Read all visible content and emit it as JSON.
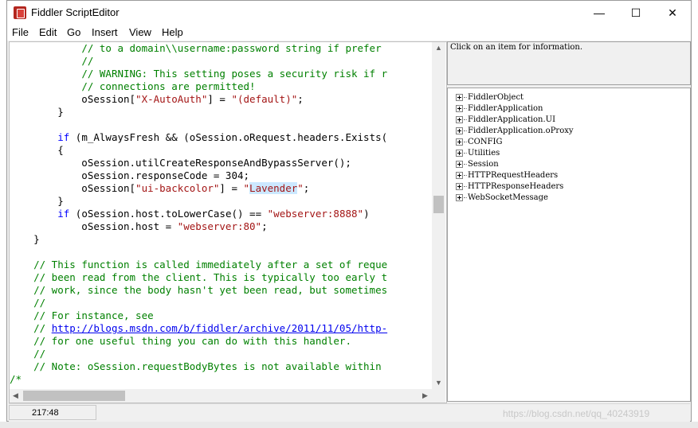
{
  "window": {
    "title": "Fiddler ScriptEditor",
    "min_glyph": "—",
    "max_glyph": "☐",
    "close_glyph": "✕"
  },
  "menu": [
    "File",
    "Edit",
    "Go",
    "Insert",
    "View",
    "Help"
  ],
  "code_lines": [
    [
      {
        "t": "            ",
        "c": ""
      },
      {
        "t": "// to a domain\\\\username:password string if prefer",
        "c": "c-comment"
      }
    ],
    [
      {
        "t": "            ",
        "c": ""
      },
      {
        "t": "//",
        "c": "c-comment"
      }
    ],
    [
      {
        "t": "            ",
        "c": ""
      },
      {
        "t": "// WARNING: This setting poses a security risk if r",
        "c": "c-comment"
      }
    ],
    [
      {
        "t": "            ",
        "c": ""
      },
      {
        "t": "// connections are permitted!",
        "c": "c-comment"
      }
    ],
    [
      {
        "t": "            oSession[",
        "c": ""
      },
      {
        "t": "\"X-AutoAuth\"",
        "c": "c-str"
      },
      {
        "t": "] = ",
        "c": ""
      },
      {
        "t": "\"(default)\"",
        "c": "c-str"
      },
      {
        "t": ";",
        "c": ""
      }
    ],
    [
      {
        "t": "        }",
        "c": ""
      }
    ],
    [
      {
        "t": "",
        "c": ""
      }
    ],
    [
      {
        "t": "        ",
        "c": ""
      },
      {
        "t": "if",
        "c": "c-key"
      },
      {
        "t": " (m_AlwaysFresh && (oSession.oRequest.headers.Exists(",
        "c": ""
      }
    ],
    [
      {
        "t": "        {",
        "c": ""
      }
    ],
    [
      {
        "t": "            oSession.utilCreateResponseAndBypassServer();",
        "c": ""
      }
    ],
    [
      {
        "t": "            oSession.responseCode = 304;",
        "c": ""
      }
    ],
    [
      {
        "t": "            oSession[",
        "c": ""
      },
      {
        "t": "\"ui-backcolor\"",
        "c": "c-str"
      },
      {
        "t": "] = ",
        "c": ""
      },
      {
        "t": "\"",
        "c": "c-str"
      },
      {
        "t": "Lavender",
        "c": "c-str c-sel"
      },
      {
        "t": "\"",
        "c": "c-str"
      },
      {
        "t": ";",
        "c": ""
      }
    ],
    [
      {
        "t": "        }",
        "c": ""
      }
    ],
    [
      {
        "t": "        ",
        "c": ""
      },
      {
        "t": "if",
        "c": "c-key"
      },
      {
        "t": " (oSession.host.toLowerCase() == ",
        "c": ""
      },
      {
        "t": "\"webserver:8888\"",
        "c": "c-str"
      },
      {
        "t": ")",
        "c": ""
      }
    ],
    [
      {
        "t": "            oSession.host = ",
        "c": ""
      },
      {
        "t": "\"webserver:80\"",
        "c": "c-str"
      },
      {
        "t": ";",
        "c": ""
      }
    ],
    [
      {
        "t": "    }",
        "c": ""
      }
    ],
    [
      {
        "t": "",
        "c": ""
      }
    ],
    [
      {
        "t": "    ",
        "c": ""
      },
      {
        "t": "// This function is called immediately after a set of reque",
        "c": "c-comment"
      }
    ],
    [
      {
        "t": "    ",
        "c": ""
      },
      {
        "t": "// been read from the client. This is typically too early t",
        "c": "c-comment"
      }
    ],
    [
      {
        "t": "    ",
        "c": ""
      },
      {
        "t": "// work, since the body hasn't yet been read, but sometimes",
        "c": "c-comment"
      }
    ],
    [
      {
        "t": "    ",
        "c": ""
      },
      {
        "t": "//",
        "c": "c-comment"
      }
    ],
    [
      {
        "t": "    ",
        "c": ""
      },
      {
        "t": "// For instance, see",
        "c": "c-comment"
      }
    ],
    [
      {
        "t": "    ",
        "c": ""
      },
      {
        "t": "// ",
        "c": "c-comment"
      },
      {
        "t": "http://blogs.msdn.com/b/fiddler/archive/2011/11/05/http-",
        "c": "c-link"
      }
    ],
    [
      {
        "t": "    ",
        "c": ""
      },
      {
        "t": "// for one useful thing you can do with this handler.",
        "c": "c-comment"
      }
    ],
    [
      {
        "t": "    ",
        "c": ""
      },
      {
        "t": "//",
        "c": "c-comment"
      }
    ],
    [
      {
        "t": "    ",
        "c": ""
      },
      {
        "t": "// Note: oSession.requestBodyBytes is not available within",
        "c": "c-comment"
      }
    ],
    [
      {
        "t": "/*",
        "c": "c-comment"
      }
    ]
  ],
  "info": "Click on an item for information.",
  "tree": [
    "FiddlerObject",
    "FiddlerApplication",
    "FiddlerApplication.UI",
    "FiddlerApplication.oProxy",
    "CONFIG",
    "Utilities",
    "Session",
    "HTTPRequestHeaders",
    "HTTPResponseHeaders",
    "WebSocketMessage"
  ],
  "status": {
    "position": "217:48"
  },
  "watermark": "https://blog.csdn.net/qq_40243919",
  "colors": {
    "comment": "#008000",
    "keyword": "#0000ff",
    "string": "#a31515",
    "selection": "#cce8ff"
  }
}
